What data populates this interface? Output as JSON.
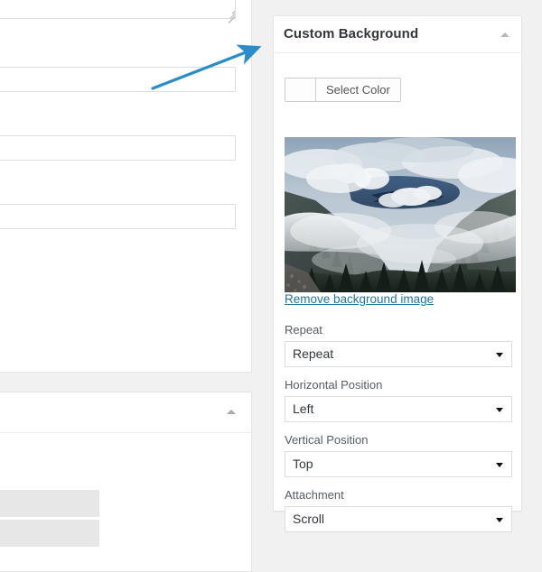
{
  "panel": {
    "title": "Custom Background",
    "collapse_icon": "caret-up-icon",
    "color": {
      "swatch_value": "",
      "button_label": "Select Color"
    },
    "preview": {
      "alt": "Misty mountain forest background preview"
    },
    "remove_link_label": "Remove background image",
    "fields": [
      {
        "label": "Repeat",
        "value": "Repeat"
      },
      {
        "label": "Horizontal Position",
        "value": "Left"
      },
      {
        "label": "Vertical Position",
        "value": "Top"
      },
      {
        "label": "Attachment",
        "value": "Scroll"
      }
    ]
  },
  "left": {
    "textarea_value": "",
    "inputs": [
      "",
      "",
      ""
    ],
    "panel_collapse_icon": "caret-up-icon"
  },
  "annotation": {
    "arrow_color": "#2b8ccc"
  },
  "colors": {
    "link": "#21759b",
    "page_bg": "#f1f1f1",
    "panel_bg": "#ffffff",
    "border": "#e5e5e5"
  }
}
